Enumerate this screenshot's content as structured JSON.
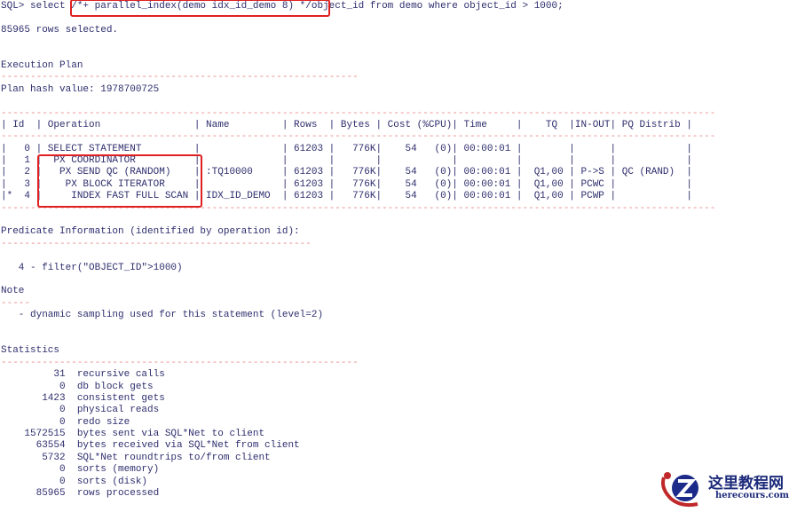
{
  "terminal": {
    "lines": [
      "SQL> select /*+ parallel_index(demo idx_id_demo 8) */object_id from demo where object_id > 1000;",
      "",
      "85965 rows selected.",
      "",
      "",
      "Execution Plan",
      "-------------------------------------------------------------",
      "Plan hash value: 1978700725",
      "",
      "--------------------------------------------------------------------------------------------------------------------------",
      "| Id  | Operation                | Name         | Rows  | Bytes | Cost (%CPU)| Time     |    TQ  |IN-OUT| PQ Distrib |",
      "--------------------------------------------------------------------------------------------------------------------------",
      "|   0 | SELECT STATEMENT         |              | 61203 |   776K|    54   (0)| 00:00:01 |        |      |            |",
      "|   1 |  PX COORDINATOR          |              |       |       |            |          |        |      |            |",
      "|   2 |   PX SEND QC (RANDOM)    | :TQ10000     | 61203 |   776K|    54   (0)| 00:00:01 |  Q1,00 | P->S | QC (RAND)  |",
      "|   3 |    PX BLOCK ITERATOR     |              | 61203 |   776K|    54   (0)| 00:00:01 |  Q1,00 | PCWC |            |",
      "|*  4 |     INDEX FAST FULL SCAN | IDX_ID_DEMO  | 61203 |   776K|    54   (0)| 00:00:01 |  Q1,00 | PCWP |            |",
      "--------------------------------------------------------------------------------------------------------------------------",
      "",
      "Predicate Information (identified by operation id):",
      "-----------------------------------------------------",
      "",
      "   4 - filter(\"OBJECT_ID\">1000)",
      "",
      "Note",
      "-----",
      "   - dynamic sampling used for this statement (level=2)",
      "",
      "",
      "Statistics",
      "-------------------------------------------------------------",
      "         31  recursive calls",
      "          0  db block gets",
      "       1423  consistent gets",
      "          0  physical reads",
      "          0  redo size",
      "    1572515  bytes sent via SQL*Net to client",
      "      63554  bytes received via SQL*Net from client",
      "       5732  SQL*Net roundtrips to/from client",
      "          0  sorts (memory)",
      "          0  sorts (disk)",
      "      85965  rows processed"
    ]
  },
  "watermark": {
    "name_cn": "这里教程网",
    "domain": "herecours.com"
  },
  "colors": {
    "keyword": "#3a9a9a",
    "number": "#5858c4",
    "dash": "#e88a8a",
    "highlight": "#e02020"
  }
}
